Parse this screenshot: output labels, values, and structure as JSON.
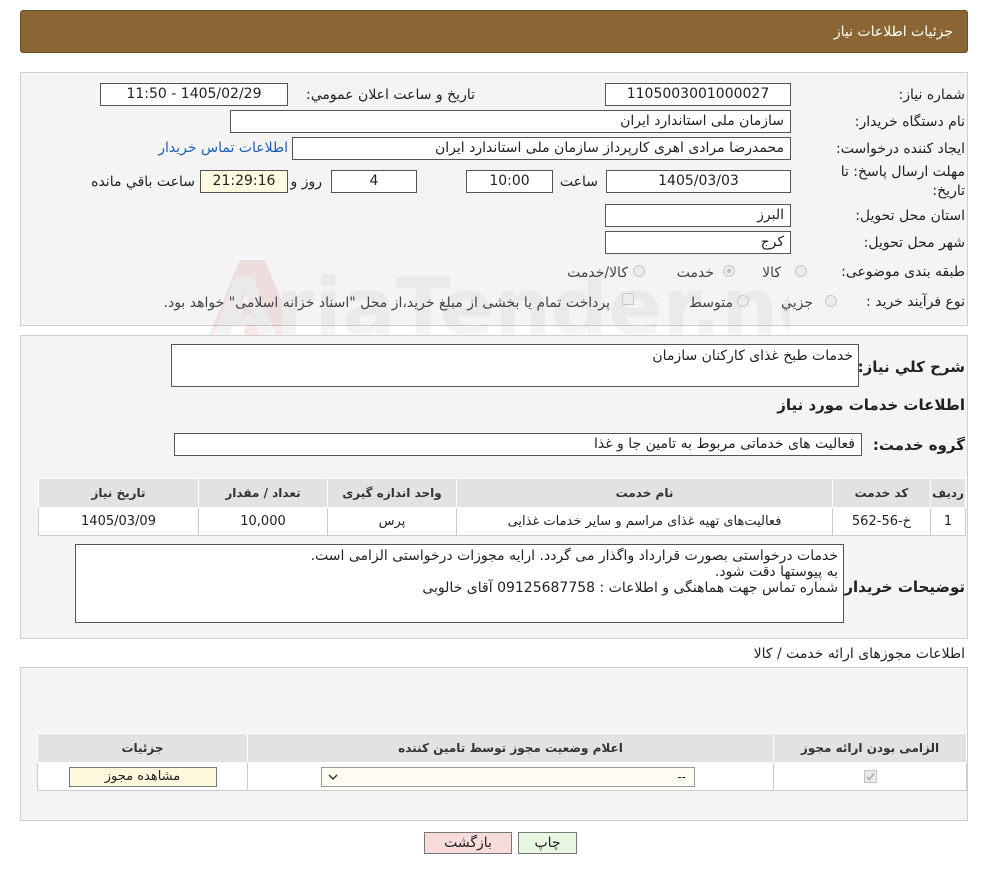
{
  "header": {
    "title": "جزئیات اطلاعات نیاز"
  },
  "fields": {
    "need_number_label": "شماره نیاز:",
    "need_number": "1105003001000027",
    "announce_label": "تاریخ و ساعت اعلان عمومي:",
    "announce_value": "1405/02/29 - 11:50",
    "buyer_org_label": "نام دستگاه خريدار:",
    "buyer_org": "سازمان ملی استاندارد ایران",
    "creator_label": "ايجاد کننده درخواست:",
    "creator": "محمدرضا مرادی اهری کارپرداز سازمان ملی استاندارد ایران",
    "contact_link": "اطلاعات تماس خريدار",
    "deadline_label_1": "مهلت ارسال پاسخ: تا",
    "deadline_label_2": "تاريخ:",
    "deadline_date": "1405/03/03",
    "time_label": "ساعت",
    "deadline_time": "10:00",
    "days": "4",
    "day_label": "روز و",
    "remaining_time": "21:29:16",
    "remaining_label": "ساعت باقي مانده",
    "province_label": "استان محل تحويل:",
    "province": "البرز",
    "city_label": "شهر محل تحويل:",
    "city": "کرج",
    "category_label": "طبقه بندی موضوعی:",
    "category_options": [
      "کالا",
      "خدمت",
      "کالا/خدمت"
    ],
    "category_selected": "خدمت",
    "process_label": "نوع فرآيند خريد :",
    "process_options": [
      "جزيي",
      "متوسط"
    ],
    "process_note": "پرداخت تمام یا بخشی از مبلغ خرید،از محل \"اسناد خزانه اسلامی\" خواهد بود."
  },
  "summary": {
    "label": "شرح کلي نياز:",
    "value": "خدمات طبخ غذای کارکنان سازمان",
    "services_heading": "اطلاعات خدمات مورد نياز",
    "group_label": "گروه خدمت:",
    "group_value": "فعالیت های خدماتی مربوط به تامین جا و غذا"
  },
  "services_table": {
    "headers": [
      "رديف",
      "کد خدمت",
      "نام خدمت",
      "واحد اندازه گيری",
      "تعداد / مقدار",
      "تاريخ نياز"
    ],
    "rows": [
      [
        "1",
        "خ-56-562",
        "فعالیت‌های تهیه غذای مراسم و سایر خدمات غذایی",
        "پرس",
        "10,000",
        "1405/03/09"
      ]
    ]
  },
  "buyer_notes": {
    "label": "توضيحات خريدار:",
    "lines": [
      "خدمات درخواستی بصورت قرارداد واگذار می گردد. ارایه مجوزات درخواستی الزامی است.",
      "به پیوستها دقت شود.",
      "شماره تماس جهت هماهنگی و اطلاعات : 09125687758 آقای خالوبی"
    ]
  },
  "permits": {
    "title": "اطلاعات مجوزهای ارائه خدمت / کالا",
    "headers": [
      "الزامی بودن ارائه مجوز",
      "اعلام وضعيت مجوز توسط تامين کننده",
      "جزئيات"
    ],
    "select_value": "--",
    "view_button": "مشاهده مجوز"
  },
  "buttons": {
    "print": "چاپ",
    "back": "بازگشت"
  },
  "watermark": "AriaTender.neT",
  "colors": {
    "header": "#8b6534",
    "link": "#1a5fb4",
    "back_button": "#f8dcdc",
    "print_button": "#e6f6e0"
  }
}
